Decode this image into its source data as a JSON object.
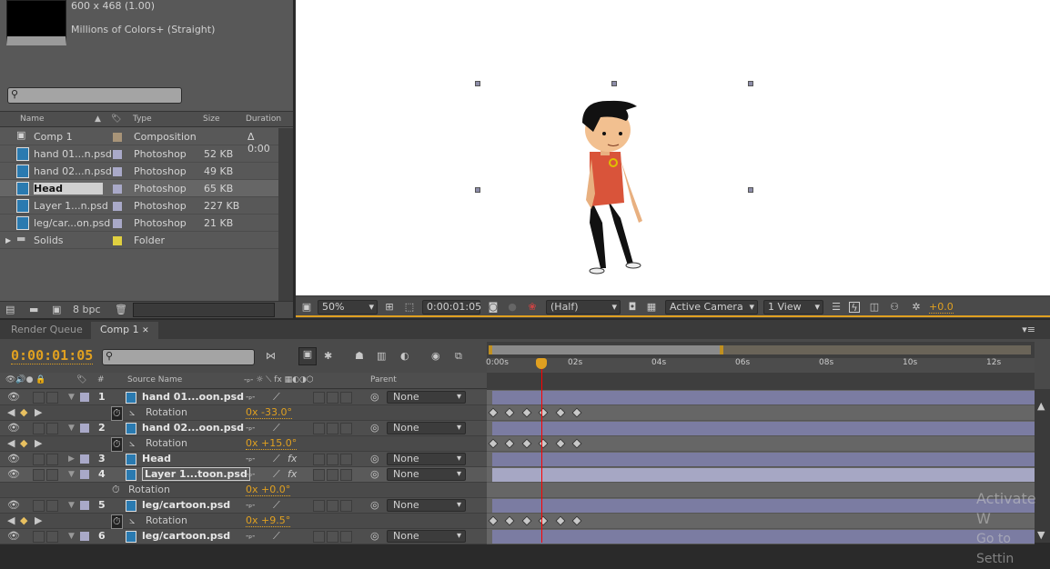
{
  "project": {
    "info_size": "600 x 468 (1.00)",
    "info_colors": "Millions of Colors+ (Straight)",
    "columns": {
      "name": "Name",
      "type": "Type",
      "size": "Size",
      "duration": "Duration"
    },
    "items": [
      {
        "name": "Comp 1",
        "color": "#a89478",
        "type": "Composition",
        "size": "",
        "duration": "Δ 0:00"
      },
      {
        "name": "hand 01...n.psd",
        "color": "#a9a9c8",
        "type": "Photoshop",
        "size": "52 KB",
        "duration": ""
      },
      {
        "name": "hand 02...n.psd",
        "color": "#a9a9c8",
        "type": "Photoshop",
        "size": "49 KB",
        "duration": ""
      },
      {
        "name": "Head",
        "color": "#a9a9c8",
        "type": "Photoshop",
        "size": "65 KB",
        "duration": ""
      },
      {
        "name": "Layer 1...n.psd",
        "color": "#a9a9c8",
        "type": "Photoshop",
        "size": "227 KB",
        "duration": ""
      },
      {
        "name": "leg/car...on.psd",
        "color": "#a9a9c8",
        "type": "Photoshop",
        "size": "21 KB",
        "duration": ""
      },
      {
        "name": "Solids",
        "color": "#e0d040",
        "type": "Folder",
        "size": "",
        "duration": ""
      }
    ],
    "bpc": "8 bpc"
  },
  "viewer": {
    "zoom": "50%",
    "timecode": "0:00:01:05",
    "resolution": "(Half)",
    "camera": "Active Camera",
    "views": "1 View",
    "exposure": "+0.0"
  },
  "timeline": {
    "tabs": [
      "Render Queue",
      "Comp 1"
    ],
    "current_time": "0:00:01:05",
    "headers": {
      "num": "#",
      "source": "Source Name",
      "parent": "Parent"
    },
    "ruler": [
      "0:00s",
      "02s",
      "04s",
      "06s",
      "08s",
      "10s",
      "12s"
    ],
    "rows": [
      {
        "kind": "layer",
        "num": "1",
        "name": "hand 01...oon.psd",
        "parent": "None",
        "fx": false,
        "expanded": true
      },
      {
        "kind": "prop",
        "name": "Rotation",
        "value": "0x -33.0°",
        "keyframes": [
          0,
          0.4,
          0.8,
          1.2,
          1.6,
          2.0
        ]
      },
      {
        "kind": "layer",
        "num": "2",
        "name": "hand 02...oon.psd",
        "parent": "None",
        "fx": false,
        "expanded": true
      },
      {
        "kind": "prop",
        "name": "Rotation",
        "value": "0x +15.0°",
        "keyframes": [
          0,
          0.4,
          0.8,
          1.2,
          1.6,
          2.0
        ]
      },
      {
        "kind": "layer",
        "num": "3",
        "name": "Head",
        "parent": "None",
        "fx": true,
        "expanded": false
      },
      {
        "kind": "layer",
        "num": "4",
        "name": "Layer 1...toon.psd",
        "parent": "None",
        "fx": true,
        "expanded": true,
        "selected": true
      },
      {
        "kind": "prop",
        "name": "Rotation",
        "value": "0x +0.0°",
        "keyframes": []
      },
      {
        "kind": "layer",
        "num": "5",
        "name": "leg/cartoon.psd",
        "parent": "None",
        "fx": false,
        "expanded": true
      },
      {
        "kind": "prop",
        "name": "Rotation",
        "value": "0x +9.5°",
        "keyframes": [
          0,
          0.4,
          0.8,
          1.2,
          1.6,
          2.0
        ]
      },
      {
        "kind": "layer",
        "num": "6",
        "name": "leg/cartoon.psd",
        "parent": "None",
        "fx": false,
        "expanded": true
      }
    ],
    "playhead_seconds": 1.2,
    "work_area_end_seconds": 5.6
  },
  "watermark": {
    "line1": "Activate W",
    "line2": "Go to Settin"
  }
}
